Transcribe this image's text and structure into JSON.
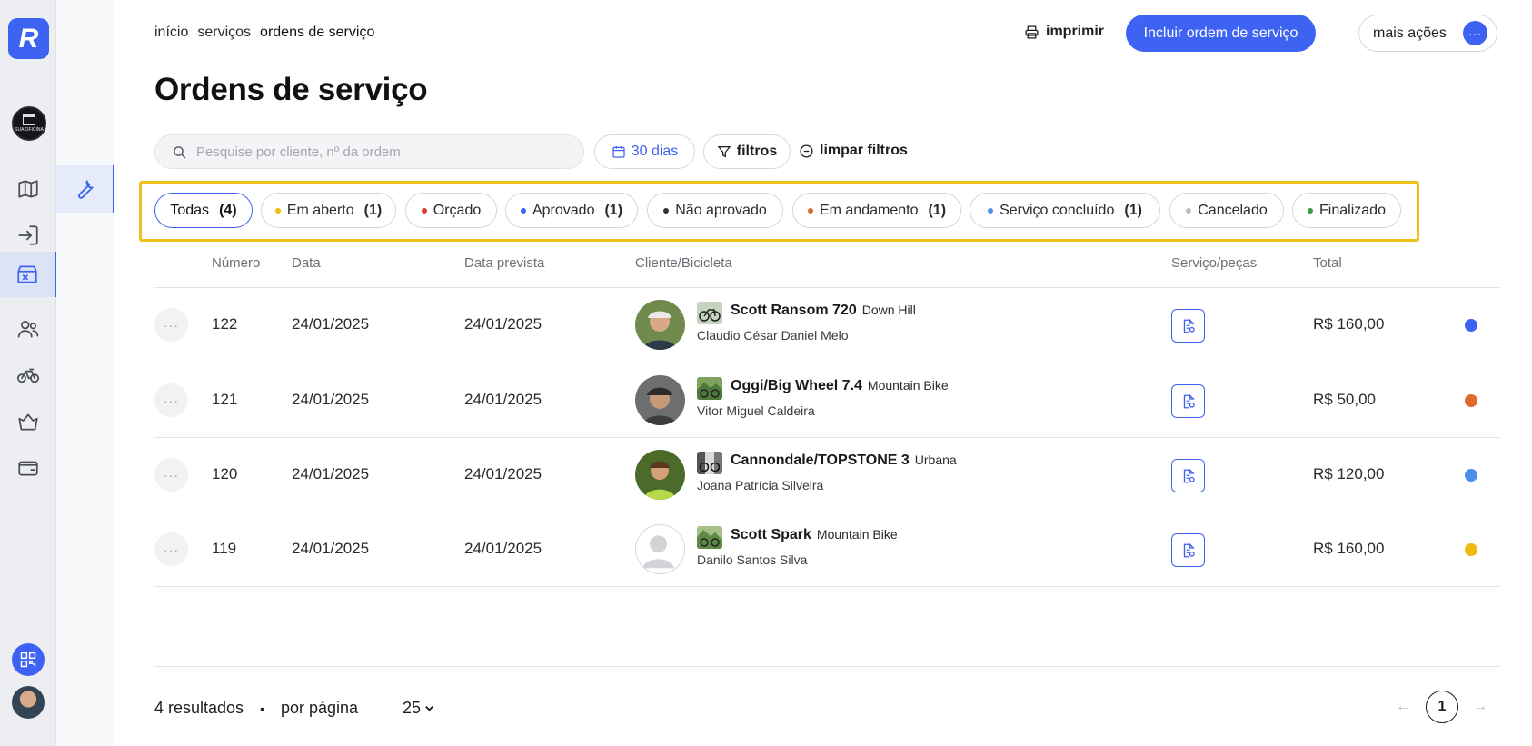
{
  "breadcrumb": [
    "início",
    "serviços",
    "ordens de serviço"
  ],
  "header": {
    "print_label": "imprimir",
    "primary_label": "Incluir ordem de serviço",
    "more_label": "mais ações",
    "more_dots": "···"
  },
  "page_title": "Ordens de serviço",
  "rail": {
    "logo": "R",
    "icons": [
      "map-icon",
      "login-icon",
      "store-icon",
      "users-icon",
      "bike-icon",
      "basket-icon",
      "wallet-icon"
    ],
    "accent": "#3e63f2"
  },
  "filters": {
    "search_placeholder": "Pesquise por cliente, nº da ordem",
    "days_label": "30 dias",
    "filters_label": "filtros",
    "clear_label": "limpar filtros"
  },
  "status_tabs": [
    {
      "label": "Todas",
      "count": "(4)",
      "dot": "",
      "active": true
    },
    {
      "label": "Em aberto",
      "count": "(1)",
      "dot": "#f0b90b"
    },
    {
      "label": "Orçado",
      "count": "",
      "dot": "#d93a3a"
    },
    {
      "label": "Aprovado",
      "count": "(1)",
      "dot": "#3e63f2"
    },
    {
      "label": "Não aprovado",
      "count": "",
      "dot": "#333338"
    },
    {
      "label": "Em andamento",
      "count": "(1)",
      "dot": "#e06a2b"
    },
    {
      "label": "Serviço concluído",
      "count": "(1)",
      "dot": "#4a8fe8"
    },
    {
      "label": "Cancelado",
      "count": "",
      "dot": "#b9bcc2"
    },
    {
      "label": "Finalizado",
      "count": "",
      "dot": "#3e9a44"
    }
  ],
  "table": {
    "columns": [
      "Número",
      "Data",
      "Data prevista",
      "Cliente/Bicicleta",
      "Serviço/peças",
      "Total"
    ],
    "rows": [
      {
        "number": "122",
        "date": "24/01/2025",
        "due": "24/01/2025",
        "bike": "Scott Ransom 720",
        "bike_type": "Down Hill",
        "client": "Claudio César Daniel Melo",
        "total": "R$ 160,00",
        "status_color": "#3e63f2",
        "photo": "person"
      },
      {
        "number": "121",
        "date": "24/01/2025",
        "due": "24/01/2025",
        "bike": "Oggi/Big Wheel 7.4",
        "bike_type": "Mountain Bike",
        "client": "Vitor Miguel Caldeira",
        "total": "R$ 50,00",
        "status_color": "#e06a2b",
        "photo": "person"
      },
      {
        "number": "120",
        "date": "24/01/2025",
        "due": "24/01/2025",
        "bike": "Cannondale/TOPSTONE 3",
        "bike_type": "Urbana",
        "client": "Joana Patrícia Silveira",
        "total": "R$ 120,00",
        "status_color": "#4a8fe8",
        "photo": "person"
      },
      {
        "number": "119",
        "date": "24/01/2025",
        "due": "24/01/2025",
        "bike": "Scott Spark",
        "bike_type": "Mountain Bike",
        "client": "Danilo Santos Silva",
        "total": "R$ 160,00",
        "status_color": "#f0b90b",
        "photo": "placeholder"
      }
    ]
  },
  "footer": {
    "results": "4 resultados",
    "bullet": "•",
    "per_page_label": "por página",
    "per_page_value": "25",
    "prev": "←",
    "current_page": "1",
    "next": "→"
  }
}
